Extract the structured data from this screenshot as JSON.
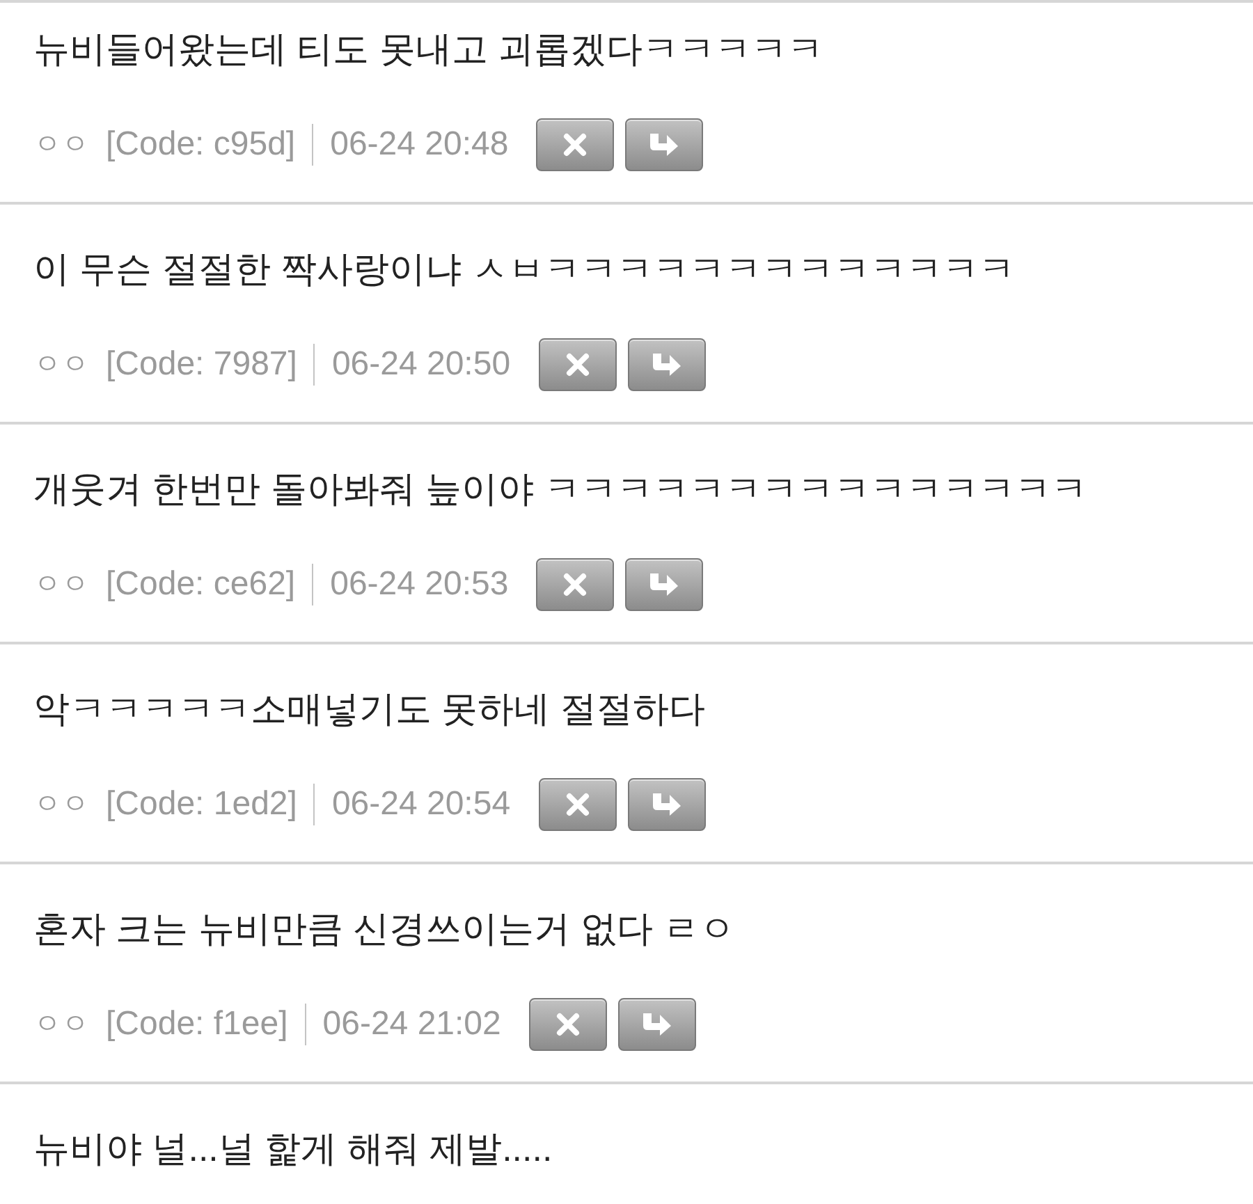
{
  "comments": [
    {
      "text": "뉴비들어왔는데 티도 못내고 괴롭겠다ㅋㅋㅋㅋㅋ",
      "meta": {
        "author": "ㅇㅇ",
        "code": "[Code: c95d]",
        "time": "06-24 20:48"
      }
    },
    {
      "text": "이 무슨 절절한 짝사랑이냐 ㅅㅂㅋㅋㅋㅋㅋㅋㅋㅋㅋㅋㅋㅋㅋ",
      "meta": {
        "author": "ㅇㅇ",
        "code": "[Code: 7987]",
        "time": "06-24 20:50"
      }
    },
    {
      "text": "개웃겨 한번만 돌아봐줘 늪이야 ㅋㅋㅋㅋㅋㅋㅋㅋㅋㅋㅋㅋㅋㅋㅋ",
      "meta": {
        "author": "ㅇㅇ",
        "code": "[Code: ce62]",
        "time": "06-24 20:53"
      }
    },
    {
      "text": "악ㅋㅋㅋㅋㅋ소매넣기도 못하네 절절하다",
      "meta": {
        "author": "ㅇㅇ",
        "code": "[Code: 1ed2]",
        "time": "06-24 20:54"
      }
    },
    {
      "text": "혼자 크는 뉴비만큼 신경쓰이는거 없다 ㄹㅇ",
      "meta": {
        "author": "ㅇㅇ",
        "code": "[Code: f1ee]",
        "time": "06-24 21:02"
      }
    },
    {
      "text": "뉴비야 널...널 핥게 해줘 제발....."
    }
  ]
}
